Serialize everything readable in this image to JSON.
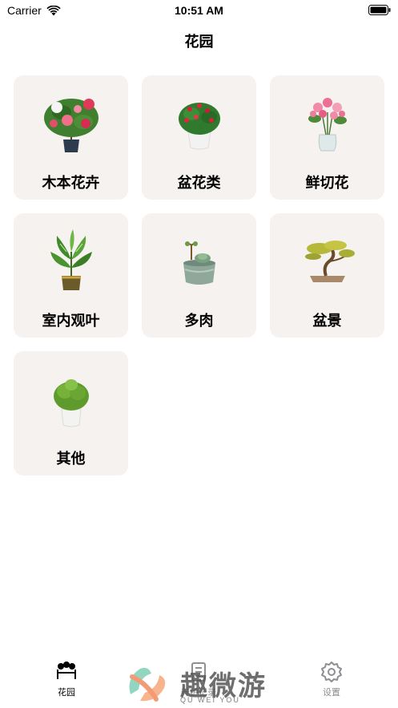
{
  "status": {
    "carrier": "Carrier",
    "time": "10:51 AM"
  },
  "nav": {
    "title": "花园"
  },
  "categories": [
    {
      "label": "木本花卉",
      "icon": "camellia-plant-icon"
    },
    {
      "label": "盆花类",
      "icon": "potted-flower-icon"
    },
    {
      "label": "鲜切花",
      "icon": "cut-flower-vase-icon"
    },
    {
      "label": "室内观叶",
      "icon": "foliage-plant-icon"
    },
    {
      "label": "多肉",
      "icon": "succulent-pot-icon"
    },
    {
      "label": "盆景",
      "icon": "bonsai-icon"
    },
    {
      "label": "其他",
      "icon": "green-shrub-pot-icon"
    }
  ],
  "tabs": [
    {
      "label": "花园",
      "icon": "garden-icon",
      "active": true
    },
    {
      "label": "养护记录",
      "icon": "care-record-icon",
      "active": false
    },
    {
      "label": "设置",
      "icon": "gear-icon",
      "active": false
    }
  ],
  "watermark": {
    "text": "趣微游",
    "sub": "QU WEI YOU"
  },
  "colors": {
    "card_bg": "#f5f2ef",
    "inactive_tab": "#8e8e93"
  }
}
